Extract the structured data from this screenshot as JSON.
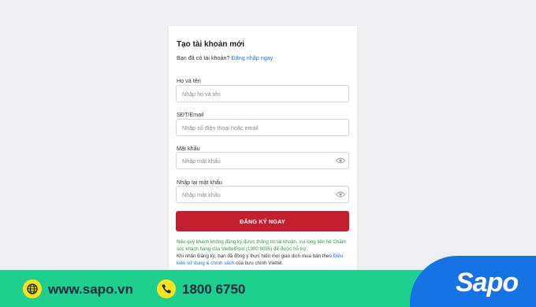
{
  "form": {
    "title": "Tạo tài khoản mới",
    "have_account_text": "Bạn đã có tài khoản?",
    "login_link": "Đăng nhập ngay",
    "fields": [
      {
        "label": "Họ và tên",
        "placeholder": "Nhập họ và tên"
      },
      {
        "label": "SĐT/Email",
        "placeholder": "Nhập số điện thoại hoặc email"
      },
      {
        "label": "Mật khẩu",
        "placeholder": "Nhập mật khẩu",
        "icon": "eye-icon"
      },
      {
        "label": "Nhập lại mật khẩu",
        "placeholder": "Nhập mật khẩu",
        "icon": "eye-icon"
      }
    ],
    "submit_label": "ĐĂNG KÝ NGAY",
    "submit_color": "#c41f2e",
    "notice_support": "Nếu quý khách không đăng ký được thông tin tài khoản, vui lòng liên hệ Chăm sóc khách hàng của ViettelPost (1900 8095) để được hỗ trợ.",
    "notice_terms_prefix": "Khi nhấn Đăng ký, bạn đã đồng ý thực hiện mọi giao dịch mua bán theo",
    "notice_terms_link": "Điều kiện sử dụng & chính sách",
    "notice_terms_suffix": "của bưu chính Viettel."
  },
  "footer": {
    "website": "www.sapo.vn",
    "phone": "1800 6750",
    "logo": "Sapo",
    "band_color": "#1ed08d",
    "logo_color": "#1673e6",
    "icon_color": "#ffe11b",
    "website_icon": "globe-icon",
    "phone_icon": "phone-icon"
  }
}
